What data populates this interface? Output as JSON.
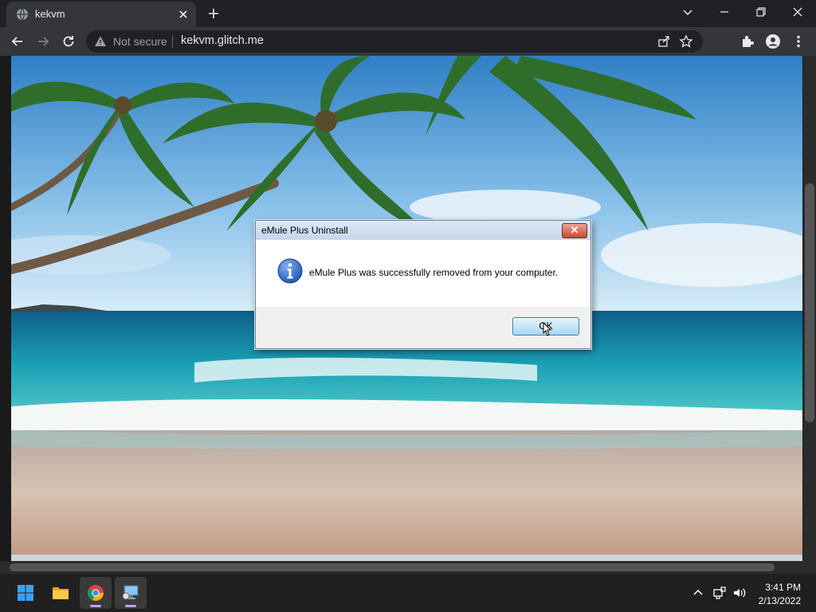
{
  "browser": {
    "tab": {
      "title": "kekvm",
      "favicon": "globe-icon"
    },
    "omnibox": {
      "security_label": "Not secure",
      "url": "kekvm.glitch.me"
    },
    "colors": {
      "frame": "#202124",
      "toolbar": "#35363a"
    }
  },
  "remote_desktop": {
    "wallpaper": "tropical-beach-palms",
    "dialog": {
      "title": "eMule Plus Uninstall",
      "message": "eMule Plus was successfully removed from your computer.",
      "ok_label": "OK",
      "icon": "info-icon",
      "close_glyph": "✕"
    }
  },
  "taskbar": {
    "apps": [
      {
        "name": "start",
        "icon": "windows-start-icon"
      },
      {
        "name": "file-explorer",
        "icon": "folder-icon"
      },
      {
        "name": "chrome",
        "icon": "chrome-icon",
        "active": true
      },
      {
        "name": "remote-desktop",
        "icon": "remote-desktop-icon"
      }
    ],
    "clock": {
      "time": "3:41 PM",
      "date": "2/13/2022"
    }
  }
}
